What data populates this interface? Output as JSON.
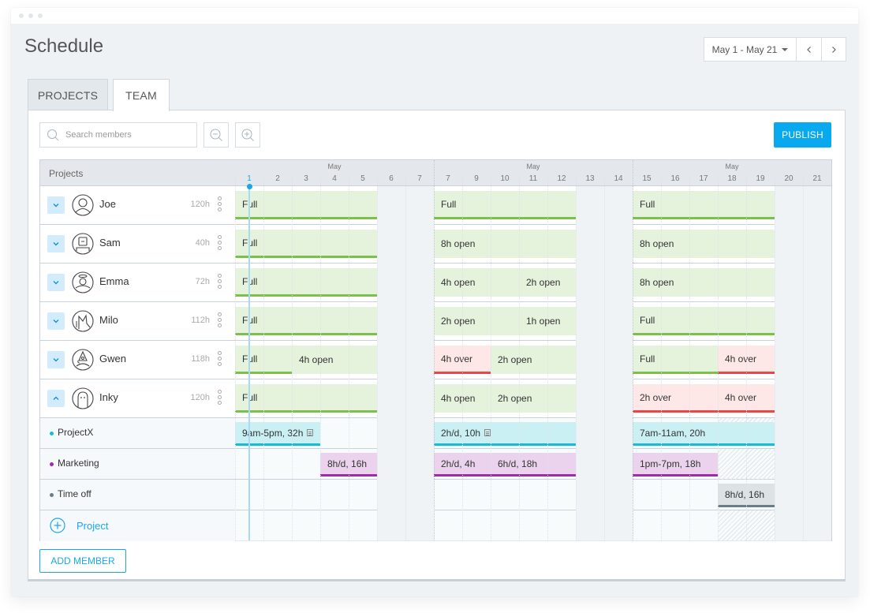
{
  "window": {
    "title": "Schedule"
  },
  "date_range": {
    "label": "May 1 - May 21",
    "prev_icon": "chevron-left-icon",
    "next_icon": "chevron-right-icon"
  },
  "tabs": [
    {
      "label": "PROJECTS",
      "active": false
    },
    {
      "label": "TEAM",
      "active": true
    }
  ],
  "toolbar": {
    "search_placeholder": "Search members",
    "search_value": "",
    "zoom_out_icon": "zoom-out-icon",
    "zoom_in_icon": "zoom-in-icon",
    "publish_label": "PUBLISH"
  },
  "grid": {
    "left_header": "Projects",
    "months": [
      {
        "label": "May",
        "over_day_index": 3
      },
      {
        "label": "May",
        "over_day_index": 10
      },
      {
        "label": "May",
        "over_day_index": 17
      }
    ],
    "days": [
      "1",
      "2",
      "3",
      "4",
      "5",
      "6",
      "7",
      "7",
      "9",
      "10",
      "11",
      "12",
      "13",
      "14",
      "15",
      "16",
      "17",
      "18",
      "19",
      "20",
      "21"
    ],
    "today_index": 0,
    "weekend_indexes": [
      5,
      6,
      12,
      13,
      19,
      20
    ],
    "week_boundaries": [
      7,
      14
    ]
  },
  "members": [
    {
      "name": "Joe",
      "hours": "120h",
      "expanded": false,
      "avatar": "person-avatar-icon",
      "bars": [
        {
          "label": "Full",
          "start": 0,
          "span": 5,
          "kind": "green",
          "underline": true
        },
        {
          "label": "Full",
          "start": 7,
          "span": 5,
          "kind": "green",
          "underline": true
        },
        {
          "label": "Full",
          "start": 14,
          "span": 5,
          "kind": "green",
          "underline": true
        }
      ]
    },
    {
      "name": "Sam",
      "hours": "40h",
      "expanded": false,
      "avatar": "robot-avatar-icon",
      "bars": [
        {
          "label": "Full",
          "start": 0,
          "span": 5,
          "kind": "green",
          "underline": true
        },
        {
          "label": "8h open",
          "start": 7,
          "span": 5,
          "kind": "green",
          "underline": false
        },
        {
          "label": "8h open",
          "start": 14,
          "span": 5,
          "kind": "green",
          "underline": false
        }
      ]
    },
    {
      "name": "Emma",
      "hours": "72h",
      "expanded": false,
      "avatar": "angel-avatar-icon",
      "bars": [
        {
          "label": "Full",
          "start": 0,
          "span": 5,
          "kind": "green",
          "underline": true
        },
        {
          "label": "4h open",
          "start": 7,
          "span": 3,
          "kind": "green",
          "underline": false
        },
        {
          "label": "2h open",
          "start": 10,
          "span": 2,
          "kind": "green",
          "underline": false
        },
        {
          "label": "8h open",
          "start": 14,
          "span": 5,
          "kind": "green",
          "underline": false
        }
      ]
    },
    {
      "name": "Milo",
      "hours": "112h",
      "expanded": false,
      "avatar": "fox-avatar-icon",
      "bars": [
        {
          "label": "Full",
          "start": 0,
          "span": 5,
          "kind": "green",
          "underline": true
        },
        {
          "label": "2h open",
          "start": 7,
          "span": 3,
          "kind": "green",
          "underline": false
        },
        {
          "label": "1h open",
          "start": 10,
          "span": 2,
          "kind": "green",
          "underline": false
        },
        {
          "label": "Full",
          "start": 14,
          "span": 5,
          "kind": "green",
          "underline": true
        }
      ]
    },
    {
      "name": "Gwen",
      "hours": "118h",
      "expanded": false,
      "avatar": "wizard-avatar-icon",
      "bars": [
        {
          "label": "Full",
          "start": 0,
          "span": 2,
          "kind": "green",
          "underline": true
        },
        {
          "label": "4h open",
          "start": 2,
          "span": 3,
          "kind": "green",
          "underline": false
        },
        {
          "label": "4h over",
          "start": 7,
          "span": 2,
          "kind": "red",
          "underline": true
        },
        {
          "label": "2h open",
          "start": 9,
          "span": 3,
          "kind": "green",
          "underline": false
        },
        {
          "label": "Full",
          "start": 14,
          "span": 3,
          "kind": "green",
          "underline": true
        },
        {
          "label": "4h over",
          "start": 17,
          "span": 2,
          "kind": "red",
          "underline": true
        }
      ]
    },
    {
      "name": "Inky",
      "hours": "120h",
      "expanded": true,
      "avatar": "ghost-avatar-icon",
      "bars": [
        {
          "label": "Full",
          "start": 0,
          "span": 5,
          "kind": "green",
          "underline": true
        },
        {
          "label": "4h open",
          "start": 7,
          "span": 2,
          "kind": "green",
          "underline": false
        },
        {
          "label": "2h open",
          "start": 9,
          "span": 3,
          "kind": "green",
          "underline": false
        },
        {
          "label": "2h over",
          "start": 14,
          "span": 3,
          "kind": "red",
          "underline": true
        },
        {
          "label": "4h over",
          "start": 17,
          "span": 2,
          "kind": "red",
          "underline": true
        }
      ]
    }
  ],
  "projects": [
    {
      "name": "ProjectX",
      "color": "#16bcd4",
      "bars": [
        {
          "label": "9am-5pm, 32h",
          "start": 0,
          "span": 3,
          "kind": "cyan",
          "note": true
        },
        {
          "label": "2h/d, 10h",
          "start": 7,
          "span": 5,
          "kind": "cyan",
          "note": true
        },
        {
          "label": "7am-11am, 20h",
          "start": 14,
          "span": 5,
          "kind": "cyan",
          "note": false
        }
      ]
    },
    {
      "name": "Marketing",
      "color": "#9c2bb0",
      "bars": [
        {
          "label": "8h/d, 16h",
          "start": 3,
          "span": 2,
          "kind": "purple",
          "note": false
        },
        {
          "label": "2h/d, 4h",
          "start": 7,
          "span": 2,
          "kind": "purple",
          "note": false
        },
        {
          "label": "6h/d, 18h",
          "start": 9,
          "span": 3,
          "kind": "purple",
          "note": false
        },
        {
          "label": "1pm-7pm, 18h",
          "start": 14,
          "span": 3,
          "kind": "purple",
          "note": false
        }
      ]
    },
    {
      "name": "Time off",
      "color": "#6b7d88",
      "bars": [
        {
          "label": "8h/d, 16h",
          "start": 17,
          "span": 2,
          "kind": "grey",
          "note": false
        }
      ]
    }
  ],
  "add_project_label": "Project",
  "add_member_label": "ADD MEMBER",
  "colors": {
    "accent": "#09a9f0",
    "full_green": "#7cbf4a",
    "over_red": "#ea4646",
    "projectx": "#16bcd4",
    "marketing": "#9c2bb0",
    "timeoff": "#6b7d88"
  }
}
